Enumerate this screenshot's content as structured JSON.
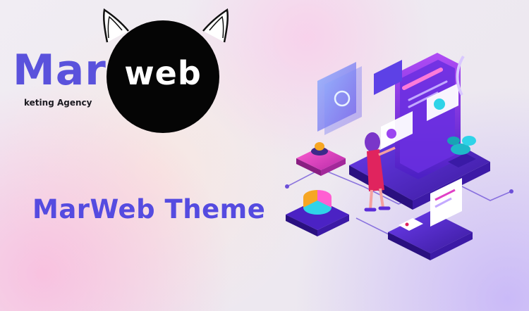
{
  "logo": {
    "prefix_text": "Mar",
    "circle_text": "web",
    "tagline": "keting Agency",
    "text_color": "#5a52dc",
    "circle_color": "#050505",
    "icon": "cat-ears-icon"
  },
  "headline": {
    "text": "MarWeb Theme",
    "color": "#554be0"
  },
  "illustration": {
    "icon": "digital-marketing-isometric-illustration",
    "accent_colors": [
      "#5b2dd8",
      "#9b45f0",
      "#e040c6",
      "#2fd3e8",
      "#f6a623"
    ]
  }
}
